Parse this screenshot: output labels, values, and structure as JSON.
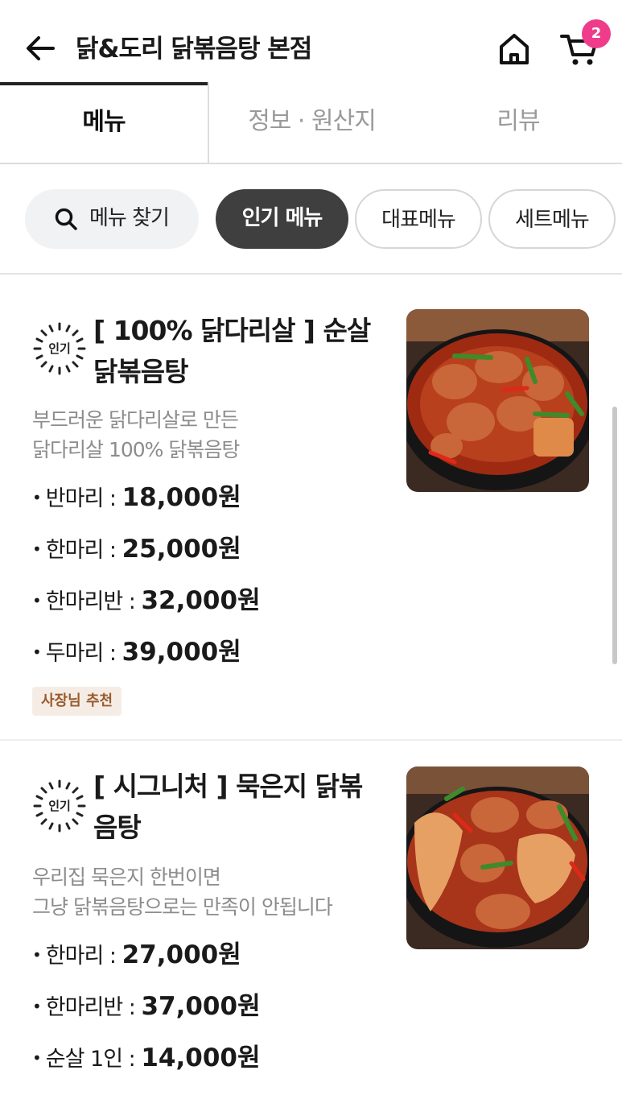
{
  "header": {
    "back_icon": "arrow-left-icon",
    "title": "닭&도리 닭볶음탕 본점",
    "home_icon": "home-icon",
    "cart_icon": "cart-icon",
    "cart_count": "2"
  },
  "tabs": [
    {
      "label": "메뉴",
      "active": true
    },
    {
      "label": "정보 · 원산지",
      "active": false
    },
    {
      "label": "리뷰",
      "active": false
    }
  ],
  "chips": {
    "search_label": "메뉴 찾기",
    "items": [
      {
        "label": "인기 메뉴",
        "active": true
      },
      {
        "label": "대표메뉴",
        "active": false
      },
      {
        "label": "세트메뉴",
        "active": false
      }
    ]
  },
  "colors": {
    "accent_badge": "#ef3c8a",
    "active_chip": "#3f3f3f",
    "owner_tag_bg": "#f5ede5",
    "owner_tag_text": "#9a5a2e"
  },
  "menu": [
    {
      "badge": "인기",
      "name_line1": "[ 100% 닭다리살 ] 순살",
      "name_line2": "닭볶음탕",
      "desc_line1": "부드러운 닭다리살로 만든",
      "desc_line2": "닭다리살 100% 닭볶음탕",
      "prices": [
        {
          "label": "반마리 :",
          "amount": "18,000원"
        },
        {
          "label": "한마리 :",
          "amount": "25,000원"
        },
        {
          "label": "한마리반 :",
          "amount": "32,000원"
        },
        {
          "label": "두마리 :",
          "amount": "39,000원"
        }
      ],
      "tag": "사장님 추천"
    },
    {
      "badge": "인기",
      "name_line1": "[ 시그니처 ] 묵은지 닭볶",
      "name_line2": "음탕",
      "desc_line1": "우리집 묵은지 한번이면",
      "desc_line2": "그냥 닭볶음탕으로는 만족이 안됩니다",
      "prices": [
        {
          "label": "한마리 :",
          "amount": "27,000원"
        },
        {
          "label": "한마리반 :",
          "amount": "37,000원"
        },
        {
          "label": "순살 1인 :",
          "amount": "14,000원"
        }
      ]
    }
  ]
}
